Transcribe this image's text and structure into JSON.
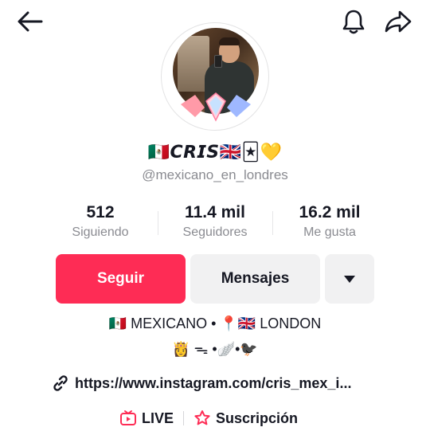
{
  "header": {
    "back_icon": "arrow-left-icon",
    "bell_icon": "bell-icon",
    "share_icon": "share-arrow-icon"
  },
  "profile": {
    "display_name": "🇲🇽𝘾𝙍𝙄𝙎🇬🇧🃏💛",
    "username": "@mexicano_en_londres"
  },
  "stats": [
    {
      "value": "512",
      "label": "Siguiendo"
    },
    {
      "value": "11.4 mil",
      "label": "Seguidores"
    },
    {
      "value": "16.2 mil",
      "label": "Me gusta"
    }
  ],
  "actions": {
    "follow_label": "Seguir",
    "message_label": "Mensajes",
    "more_icon": "caret-down-icon"
  },
  "bio": {
    "line1": "🇲🇽 MEXICANO • 📍🇬🇧 LONDON",
    "line2": "👸 ᯓ •🪽•🐦‍⬛"
  },
  "link": {
    "text": "https://www.instagram.com/cris_mex_i..."
  },
  "bottom": {
    "live_label": "LIVE",
    "subscription_label": "Suscripción"
  },
  "colors": {
    "accent": "#fe2c55",
    "secondary_button": "#f1f1f2",
    "muted_text": "#8a8b91"
  }
}
